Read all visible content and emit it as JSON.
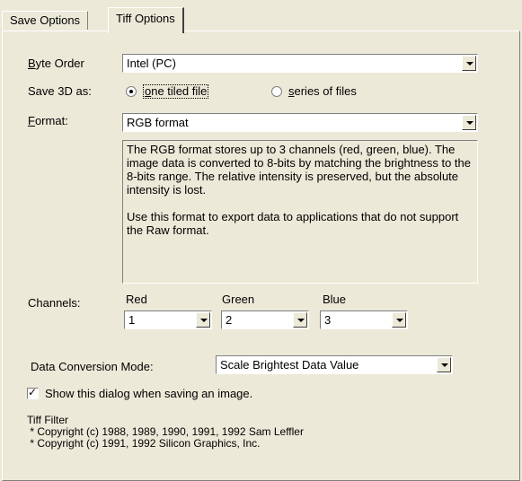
{
  "tabs": [
    {
      "label": "Save Options",
      "active": false
    },
    {
      "label": "Tiff Options",
      "active": true
    }
  ],
  "byte_order": {
    "label_underlined": "B",
    "label_rest": "yte Order",
    "value": "Intel (PC)"
  },
  "save3d": {
    "label": "Save 3D as:",
    "options": [
      {
        "underlined": "o",
        "rest": "ne tiled file",
        "selected": true
      },
      {
        "underlined": "s",
        "rest": "eries of files",
        "selected": false
      }
    ]
  },
  "format": {
    "label_underlined": "F",
    "label_rest": "ormat:",
    "value": "RGB format",
    "description": [
      "The RGB format stores up to 3 channels (red, green, blue). The image data is converted to 8-bits by matching the brightness to the 8-bits range. The relative intensity is preserved, but the absolute intensity is lost.",
      "Use this format to export data to applications that do not support the Raw format."
    ]
  },
  "channels": {
    "label": "Channels:",
    "items": [
      {
        "name": "Red",
        "value": "1"
      },
      {
        "name": "Green",
        "value": "2"
      },
      {
        "name": "Blue",
        "value": "3"
      }
    ]
  },
  "conversion": {
    "label": "Data Conversion Mode:",
    "value": "Scale Brightest Data Value"
  },
  "show_dialog": {
    "label": "Show this dialog when saving an image.",
    "checked": true
  },
  "tiff_filter": {
    "title": "Tiff Filter",
    "lines": [
      " * Copyright (c) 1988, 1989, 1990, 1991, 1992 Sam Leffler",
      " * Copyright (c) 1991, 1992 Silicon Graphics, Inc."
    ]
  }
}
